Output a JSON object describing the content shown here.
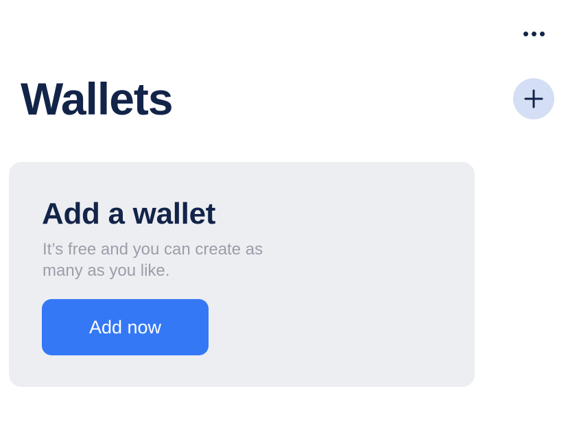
{
  "header": {
    "title": "Wallets",
    "more_icon": "more-horizontal-icon",
    "add_icon": "plus-icon"
  },
  "empty_state": {
    "title": "Add a wallet",
    "subtitle": "It’s free and you can create as many as you like.",
    "button_label": "Add now"
  },
  "colors": {
    "text_primary": "#132449",
    "text_secondary": "#9a9ea8",
    "accent": "#3478f6",
    "fab_background": "#d4def4",
    "card_background": "#edeef2"
  }
}
